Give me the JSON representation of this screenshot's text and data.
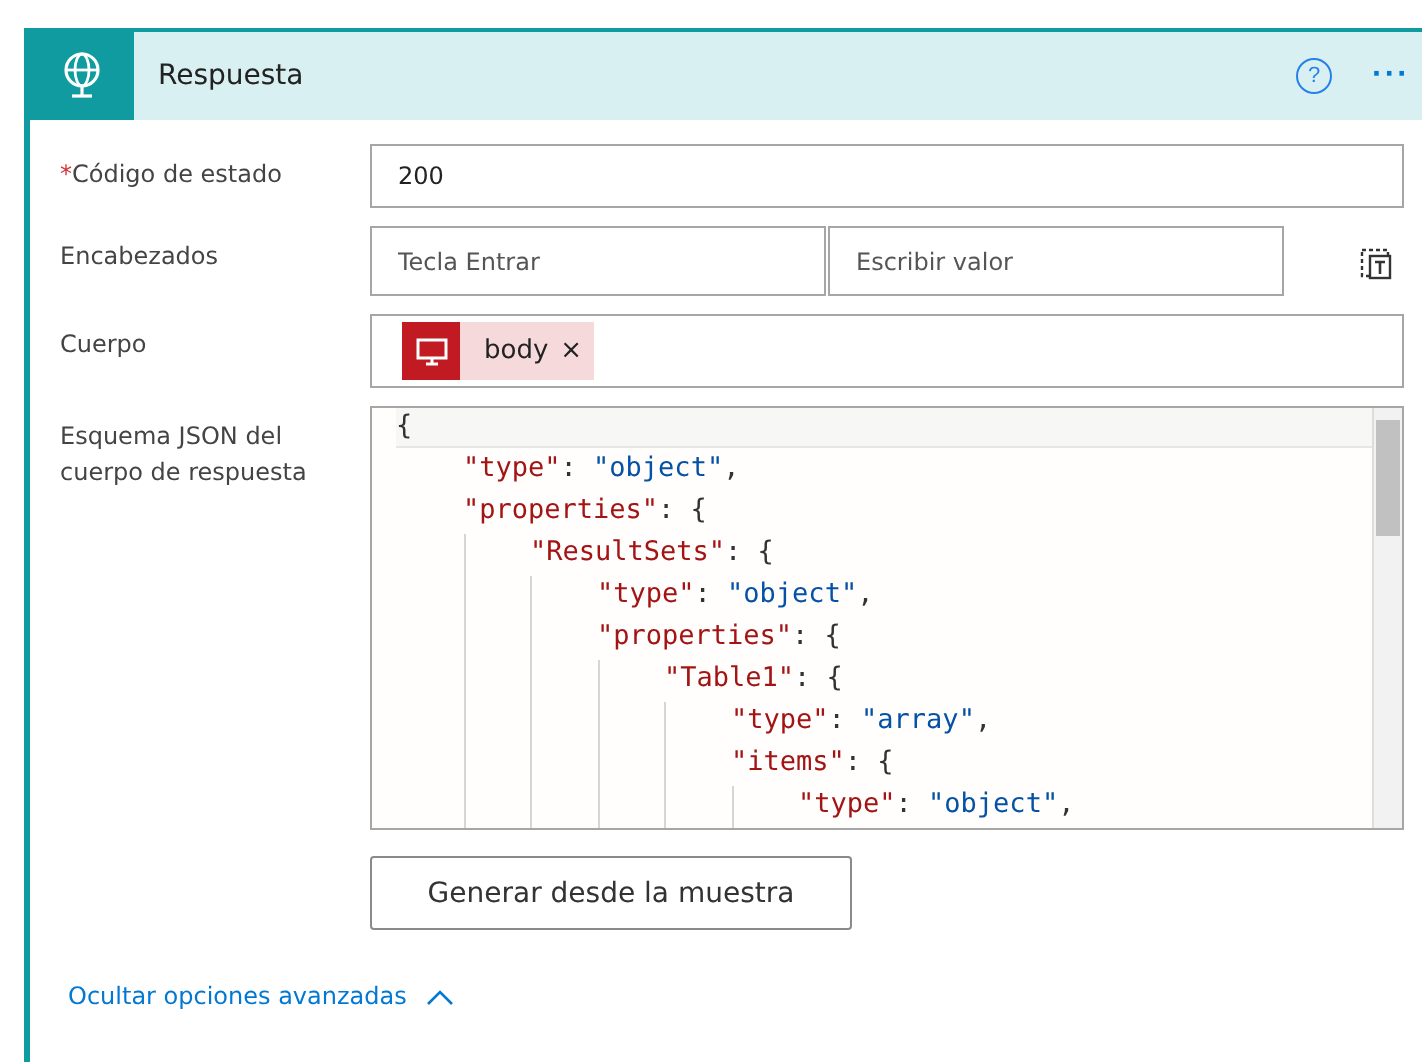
{
  "header": {
    "title": "Respuesta",
    "help_label": "?",
    "more_label": "···"
  },
  "fields": [
    {
      "kind": "text",
      "label": "Código de estado",
      "required": true,
      "value": "200"
    },
    {
      "kind": "pair",
      "label": "Encabezados",
      "required": false,
      "key_placeholder": "Tecla Entrar",
      "value_placeholder": "Escribir valor"
    },
    {
      "kind": "token",
      "label": "Cuerpo",
      "required": false,
      "token": {
        "text": "body",
        "remove": "×"
      }
    },
    {
      "kind": "code",
      "label": "Esquema JSON del cuerpo de respuesta",
      "required": false,
      "lines": [
        {
          "tokens": [
            {
              "kind": "punct",
              "text": "{"
            }
          ],
          "children": [
            {
              "tokens": [
                {
                  "kind": "key",
                  "text": "\"type\""
                },
                {
                  "kind": "punct",
                  "text": ": "
                },
                {
                  "kind": "string",
                  "text": "\"object\""
                },
                {
                  "kind": "punct",
                  "text": ","
                }
              ]
            },
            {
              "tokens": [
                {
                  "kind": "key",
                  "text": "\"properties\""
                },
                {
                  "kind": "punct",
                  "text": ": {"
                }
              ],
              "children": [
                {
                  "tokens": [
                    {
                      "kind": "key",
                      "text": "\"ResultSets\""
                    },
                    {
                      "kind": "punct",
                      "text": ": {"
                    }
                  ],
                  "children": [
                    {
                      "tokens": [
                        {
                          "kind": "key",
                          "text": "\"type\""
                        },
                        {
                          "kind": "punct",
                          "text": ": "
                        },
                        {
                          "kind": "string",
                          "text": "\"object\""
                        },
                        {
                          "kind": "punct",
                          "text": ","
                        }
                      ]
                    },
                    {
                      "tokens": [
                        {
                          "kind": "key",
                          "text": "\"properties\""
                        },
                        {
                          "kind": "punct",
                          "text": ": {"
                        }
                      ],
                      "children": [
                        {
                          "tokens": [
                            {
                              "kind": "key",
                              "text": "\"Table1\""
                            },
                            {
                              "kind": "punct",
                              "text": ": {"
                            }
                          ],
                          "children": [
                            {
                              "tokens": [
                                {
                                  "kind": "key",
                                  "text": "\"type\""
                                },
                                {
                                  "kind": "punct",
                                  "text": ": "
                                },
                                {
                                  "kind": "string",
                                  "text": "\"array\""
                                },
                                {
                                  "kind": "punct",
                                  "text": ","
                                }
                              ]
                            },
                            {
                              "tokens": [
                                {
                                  "kind": "key",
                                  "text": "\"items\""
                                },
                                {
                                  "kind": "punct",
                                  "text": ": {"
                                }
                              ],
                              "children": [
                                {
                                  "tokens": [
                                    {
                                      "kind": "key",
                                      "text": "\"type\""
                                    },
                                    {
                                      "kind": "punct",
                                      "text": ": "
                                    },
                                    {
                                      "kind": "string",
                                      "text": "\"object\""
                                    },
                                    {
                                      "kind": "punct",
                                      "text": ","
                                    }
                                  ]
                                }
                              ]
                            }
                          ]
                        }
                      ]
                    }
                  ]
                }
              ]
            }
          ]
        }
      ]
    }
  ],
  "required_marker": "*",
  "generate_button": "Generar desde la muestra",
  "advanced_link": {
    "label": "Ocultar opciones avanzadas",
    "expanded": true
  }
}
